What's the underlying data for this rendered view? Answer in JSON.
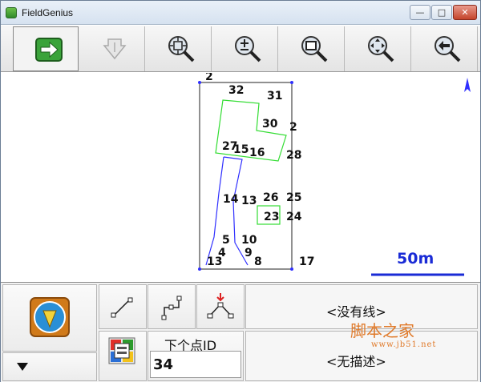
{
  "window": {
    "title": "FieldGenius",
    "min_glyph": "—",
    "max_glyph": "□",
    "close_glyph": "✕"
  },
  "toolbar": {
    "buttons": [
      {
        "name": "next",
        "icon": "green-arrow-right-icon"
      },
      {
        "name": "store-point",
        "icon": "store-point-icon"
      },
      {
        "name": "zoom-extents",
        "icon": "zoom-extents-icon"
      },
      {
        "name": "zoom-in-out",
        "icon": "zoom-plus-minus-icon"
      },
      {
        "name": "zoom-window",
        "icon": "zoom-window-icon"
      },
      {
        "name": "pan",
        "icon": "pan-icon"
      },
      {
        "name": "back",
        "icon": "zoom-back-icon"
      }
    ]
  },
  "map": {
    "point_labels": [
      "2",
      "32",
      "31",
      "30",
      "2",
      "27",
      "15",
      "16",
      "28",
      "14",
      "13",
      "26",
      "25",
      "23",
      "24",
      "5",
      "10",
      "4",
      "9",
      "13",
      "8",
      "17"
    ],
    "north_marker": "north-arrow-icon",
    "scale_label": "50m"
  },
  "bottom_panel": {
    "mode_icon": "survey-compass-icon",
    "menu_toggle_icon": "triangle-down-icon",
    "line_tools": [
      "line-tool-icon",
      "polyline-tool-icon",
      "point-insert-tool-icon"
    ],
    "layer_icon": "layer-manager-icon",
    "next_point_label": "下个点ID",
    "next_point_value": "34",
    "line_status": "<没有线>",
    "description_status": "<无描述>"
  },
  "watermark": {
    "main": "脚本之家",
    "sub": "www.jb51.net"
  },
  "colors": {
    "polygon_green": "#33dd33",
    "line_blue": "#3030ff",
    "scale_blue": "#1a2bd6"
  }
}
